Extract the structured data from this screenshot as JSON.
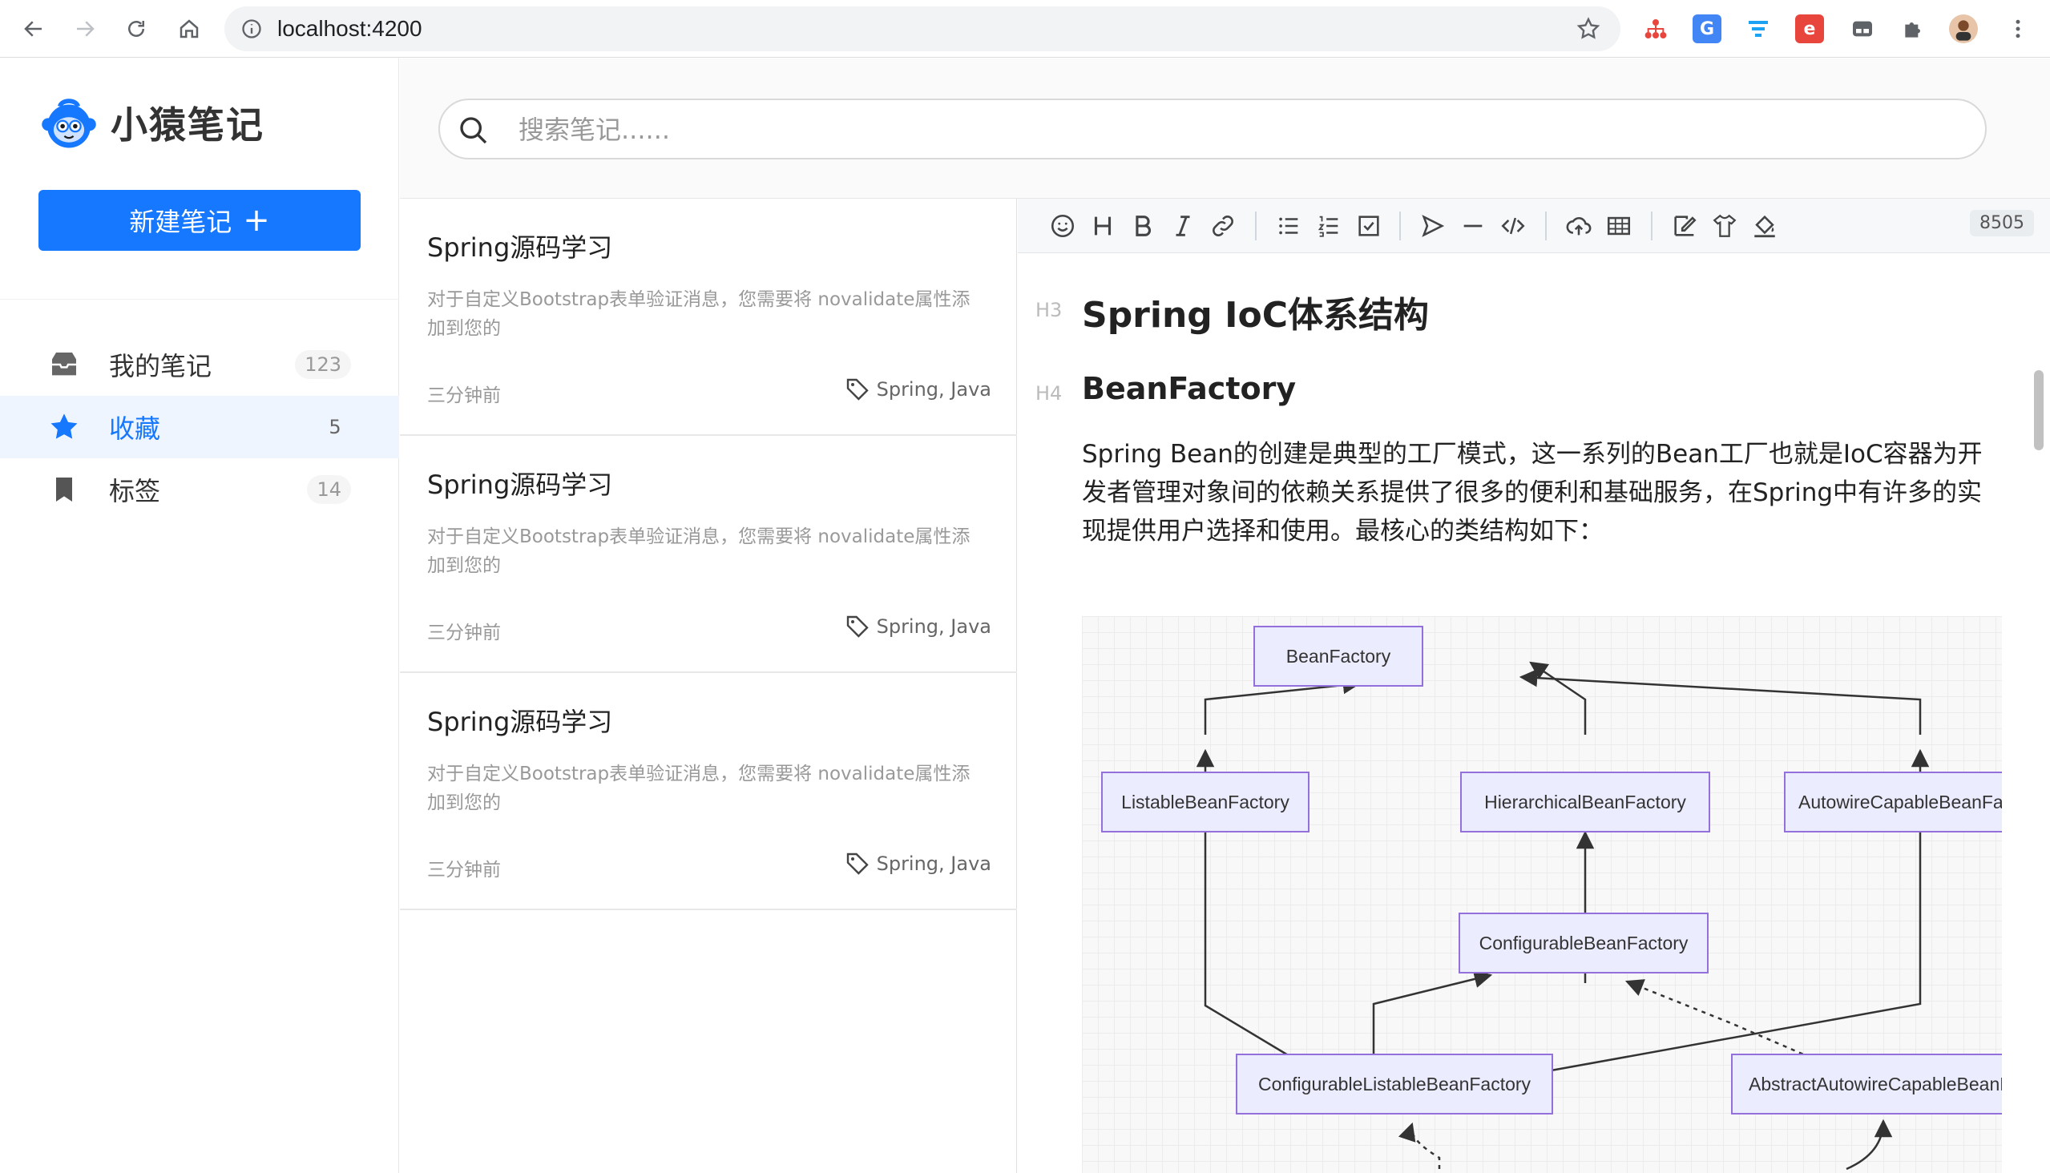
{
  "browser": {
    "url": "localhost:4200"
  },
  "app": {
    "name": "小猿笔记",
    "new_note_label": "新建笔记",
    "new_note_plus": "+"
  },
  "sidebar": {
    "items": [
      {
        "label": "我的笔记",
        "count": "123",
        "icon": "inbox-icon"
      },
      {
        "label": "收藏",
        "count": "5",
        "icon": "star-icon"
      },
      {
        "label": "标签",
        "count": "14",
        "icon": "bookmark-icon"
      }
    ]
  },
  "search": {
    "placeholder": "搜索笔记......"
  },
  "notes": [
    {
      "title": "Spring源码学习",
      "desc": "对于自定义Bootstrap表单验证消息，您需要将 novalidate属性添加到您的",
      "time": "三分钟前",
      "tags": "Spring, Java"
    },
    {
      "title": "Spring源码学习",
      "desc": "对于自定义Bootstrap表单验证消息，您需要将 novalidate属性添加到您的",
      "time": "三分钟前",
      "tags": "Spring, Java"
    },
    {
      "title": "Spring源码学习",
      "desc": "对于自定义Bootstrap表单验证消息，您需要将 novalidate属性添加到您的",
      "time": "三分钟前",
      "tags": "Spring, Java"
    }
  ],
  "editor": {
    "word_count": "8505",
    "h3_mark": "H3",
    "h3": "Spring IoC体系结构",
    "h4_mark": "H4",
    "h4": "BeanFactory",
    "paragraph": "Spring Bean的创建是典型的工厂模式，这一系列的Bean工厂也就是IoC容器为开发者管理对象间的依赖关系提供了很多的便利和基础服务，在Spring中有许多的实现提供用户选择和使用。最核心的类结构如下："
  },
  "diagram": {
    "nodes": {
      "bean_factory": "BeanFactory",
      "listable": "ListableBeanFactory",
      "hierarchical": "HierarchicalBeanFactory",
      "autowire_capable": "AutowireCapableBeanFactory",
      "configurable": "ConfigurableBeanFactory",
      "configurable_listable": "ConfigurableListableBeanFactory",
      "abstract_autowire": "AbstractAutowireCapableBeanFactory"
    }
  },
  "colors": {
    "primary": "#1677ff",
    "node_fill": "#ececff",
    "node_border": "#9370db"
  }
}
